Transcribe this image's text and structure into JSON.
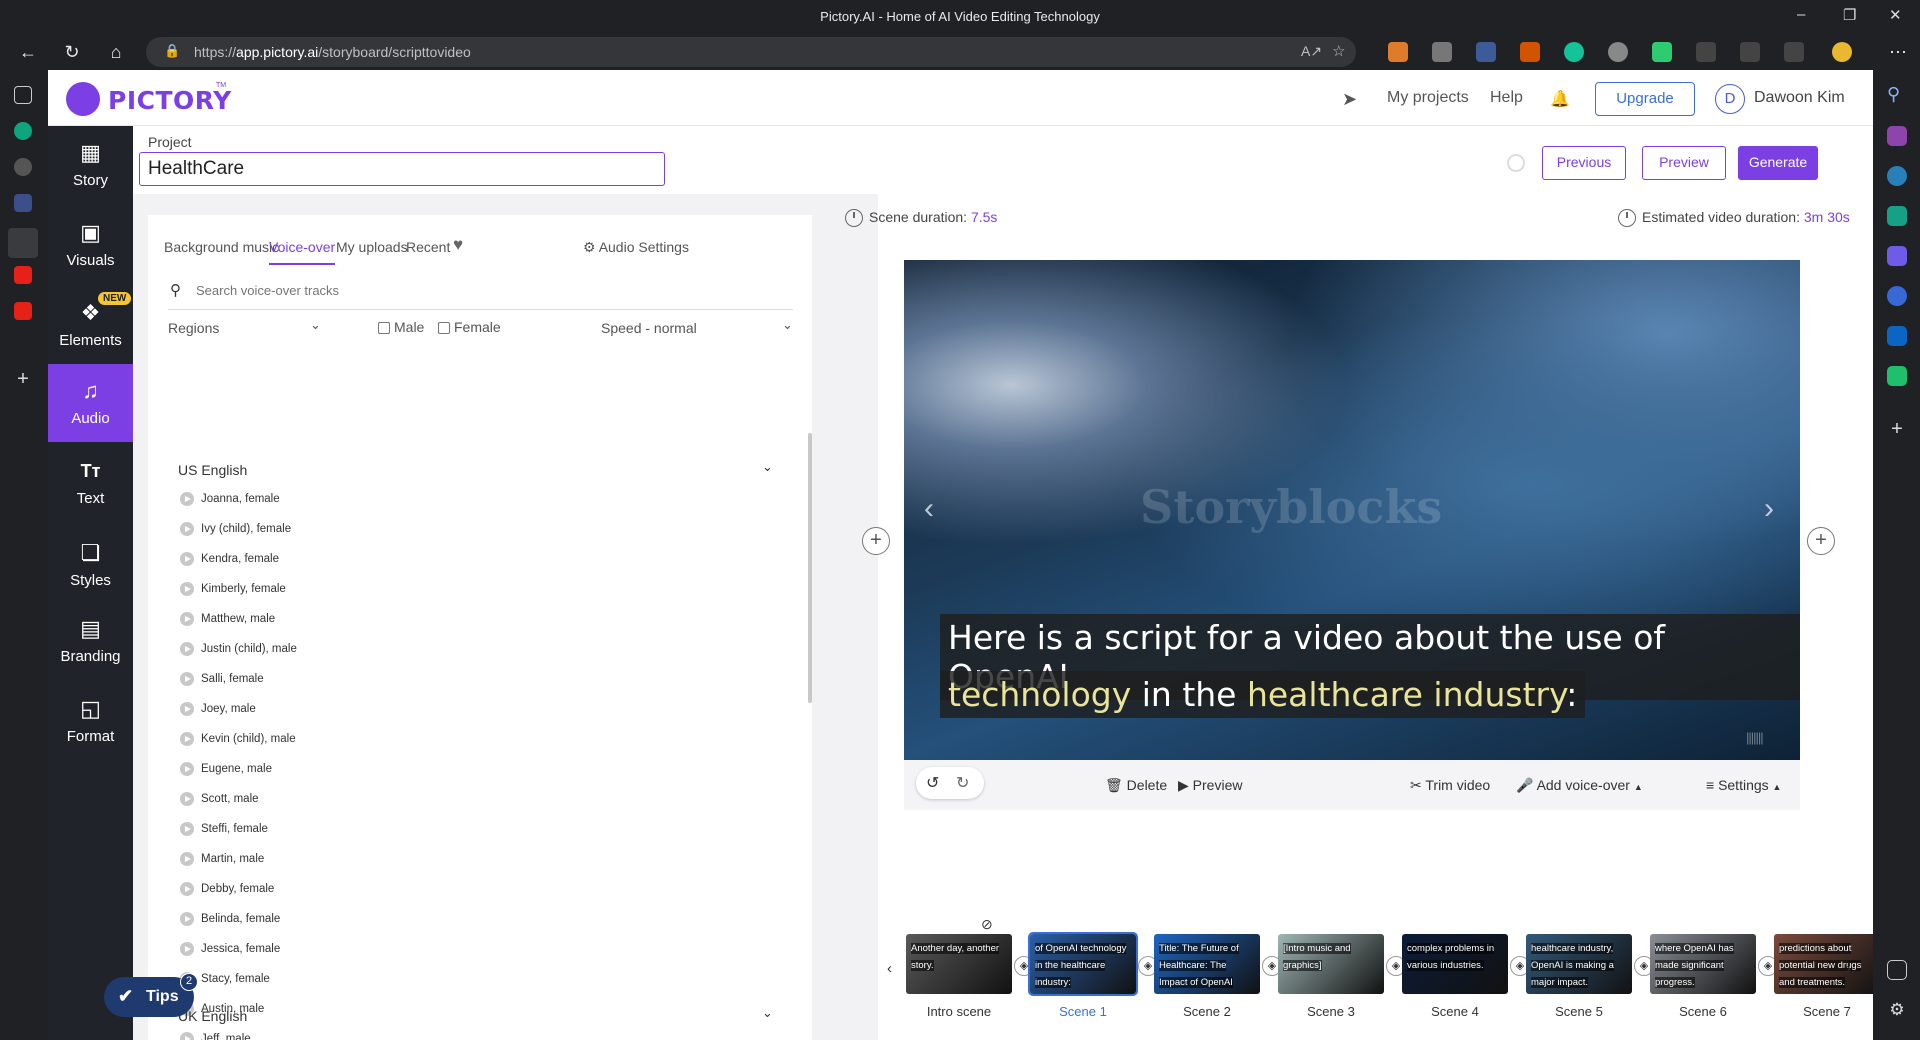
{
  "browser": {
    "window_title": "Pictory.AI - Home of AI Video Editing Technology",
    "url_prefix": "https://",
    "url_host": "app.pictory.ai",
    "url_path": "/storyboard/scripttovideo"
  },
  "header": {
    "brand": "PICTORY",
    "tm": "TM",
    "my_projects": "My projects",
    "help": "Help",
    "upgrade": "Upgrade",
    "avatar_initial": "D",
    "user_name": "Dawoon Kim"
  },
  "nav": {
    "items": [
      {
        "label": "Story",
        "icon": "story-icon"
      },
      {
        "label": "Visuals",
        "icon": "image-icon"
      },
      {
        "label": "Elements",
        "icon": "elements-icon",
        "badge": "NEW"
      },
      {
        "label": "Audio",
        "icon": "music-icon",
        "active": true
      },
      {
        "label": "Text",
        "icon": "text-icon"
      },
      {
        "label": "Styles",
        "icon": "styles-icon"
      },
      {
        "label": "Branding",
        "icon": "briefcase-icon"
      },
      {
        "label": "Format",
        "icon": "format-icon"
      }
    ]
  },
  "project": {
    "label": "Project",
    "name": "HealthCare",
    "previous": "Previous",
    "preview": "Preview",
    "generate": "Generate"
  },
  "audio_panel": {
    "tabs": [
      "Background music",
      "Voice-over",
      "My uploads",
      "Recent"
    ],
    "active_tab": "Voice-over",
    "audio_settings": "Audio Settings",
    "search_placeholder": "Search voice-over tracks",
    "regions": "Regions",
    "male": "Male",
    "female": "Female",
    "speed": "Speed - normal",
    "groups": [
      {
        "name": "US English",
        "voices": [
          "Joanna, female",
          "Ivy (child), female",
          "Kendra, female",
          "Kimberly, female",
          "Matthew, male",
          "Justin (child), male",
          "Salli, female",
          "Joey, male",
          "Kevin (child), male",
          "Eugene, male",
          "Scott, male",
          "Steffi, female",
          "Martin, male",
          "Debby, female",
          "Belinda, female",
          "Jessica, female",
          "Stacy, female",
          "Austin, male",
          "Jeff, male"
        ]
      },
      {
        "name": "UK English",
        "voices": []
      }
    ]
  },
  "editor": {
    "scene_duration_label": "Scene duration:",
    "scene_duration": "7.5s",
    "estimated_label": "Estimated video duration:",
    "estimated": "3m 30s",
    "watermark": "Storyblocks",
    "caption_line1": "Here is a script for a video about the use of OpenAI",
    "caption_line2_hl1": "technology",
    "caption_line2_mid": " in the ",
    "caption_line2_hl2": "healthcare industry",
    "caption_line2_end": ":",
    "toolbar": {
      "delete": "Delete",
      "preview": "Preview",
      "trim": "Trim video",
      "add_voice": "Add voice-over",
      "settings": "Settings"
    }
  },
  "timeline": {
    "scenes": [
      {
        "label": "Intro scene",
        "text": "Another day, another story.",
        "bg": "#5a5a5a"
      },
      {
        "label": "Scene 1",
        "text": "of OpenAI technology in the healthcare industry:",
        "bg": "#2a5fa8",
        "active": true
      },
      {
        "label": "Scene 2",
        "text": "Title: The Future of Healthcare: The Impact of OpenAI",
        "bg": "#1f66c2"
      },
      {
        "label": "Scene 3",
        "text": "[Intro music and graphics]",
        "bg": "#9fb7b5"
      },
      {
        "label": "Scene 4",
        "text": "complex problems in various industries.",
        "bg": "#0c1c38"
      },
      {
        "label": "Scene 5",
        "text": "healthcare industry, OpenAI is making a major impact.",
        "bg": "#335a7a"
      },
      {
        "label": "Scene 6",
        "text": "where OpenAI has made significant progress.",
        "bg": "#8a8f97"
      },
      {
        "label": "Scene 7",
        "text": "predictions about potential new drugs and treatments.",
        "bg": "#7a4a3c"
      }
    ]
  },
  "tips": {
    "label": "Tips",
    "count": "2"
  }
}
